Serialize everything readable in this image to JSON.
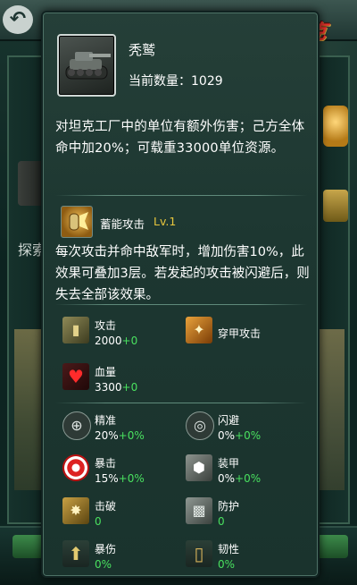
{
  "background": {
    "logo": "红警·坦克4D",
    "left_partial_label": "探索"
  },
  "popup": {
    "unit": {
      "icon": "tank-icon",
      "name": "秃鹫",
      "quantity_label": "当前数量：",
      "quantity": "1029",
      "description": "对坦克工厂中的单位有额外伤害；己方全体命中加20%；可载重33000单位资源。"
    },
    "skill": {
      "icon": "charge-attack-icon",
      "name": "蓄能攻击",
      "level": "Lv.1",
      "description": "每次攻击并命中敌军时，增加伤害10%，此效果可叠加3层。若发起的攻击被闪避后，则失去全部该效果。"
    },
    "core_stats": [
      {
        "name": "攻击",
        "base": "2000",
        "bonus": "+0",
        "icon": "shell-icon"
      },
      {
        "name": "穿甲攻击",
        "base": "",
        "bonus": "",
        "icon": "armor-pierce-icon"
      },
      {
        "name": "血量",
        "base": "3300",
        "bonus": "+0",
        "icon": "heart-icon"
      }
    ],
    "extra_stats": [
      {
        "name": "精准",
        "base": "20%",
        "bonus": "+0%",
        "icon": "crosshair-icon"
      },
      {
        "name": "闪避",
        "base": "0%",
        "bonus": "+0%",
        "icon": "dodge-icon"
      },
      {
        "name": "暴击",
        "base": "15%",
        "bonus": "+0%",
        "icon": "target-icon"
      },
      {
        "name": "装甲",
        "base": "0%",
        "bonus": "+0%",
        "icon": "armor-icon"
      },
      {
        "name": "击破",
        "base": "0",
        "bonus": "",
        "icon": "break-icon"
      },
      {
        "name": "防护",
        "base": "0",
        "bonus": "",
        "icon": "shield-icon"
      },
      {
        "name": "暴伤",
        "base": "0%",
        "bonus": "",
        "icon": "crit-damage-icon"
      },
      {
        "name": "韧性",
        "base": "0%",
        "bonus": "",
        "icon": "toughness-icon"
      }
    ]
  },
  "colors": {
    "popup_bg": "#1d3731",
    "bonus_green": "#49e05f",
    "level_yellow": "#e7c63d",
    "text": "#ffffff"
  }
}
